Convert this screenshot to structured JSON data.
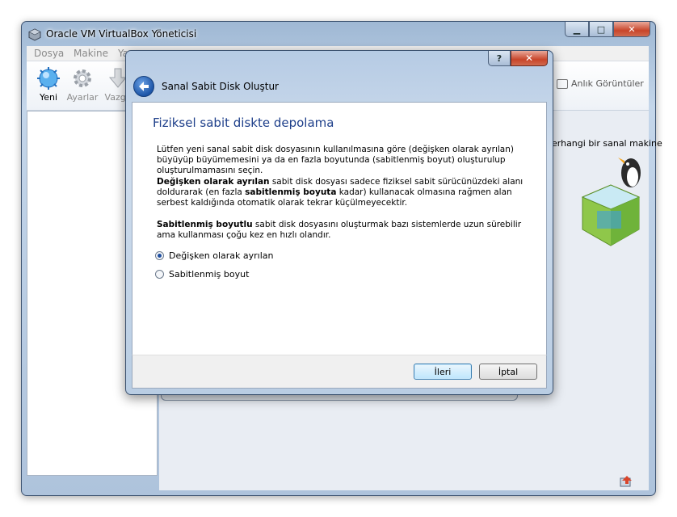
{
  "main_window": {
    "title": "Oracle VM VirtualBox Yöneticisi",
    "menu": [
      "Dosya",
      "Makine",
      "Ya"
    ],
    "toolbar": {
      "new_label": "Yeni",
      "settings_label": "Ayarlar",
      "discard_label": "Vazge",
      "snapshots_label": "Anlık Görüntüler"
    },
    "welcome_text": "erhangi bir sanal makine"
  },
  "dialog": {
    "title": "Sanal Sabit Disk Oluştur",
    "heading": "Fiziksel sabit diskte depolama",
    "intro": "Lütfen yeni sanal sabit disk dosyasının kullanılmasına göre (değişken olarak ayrılan) büyüyüp büyümemesini ya da en fazla boyutunda (sabitlenmiş boyut) oluşturulup oluşturulmamasını seçin.",
    "dynamic_para": {
      "bold1": "Değişken olarak ayrılan",
      "text1": " sabit disk dosyası sadece fiziksel sabit sürücünüzdeki alanı doldurarak (en fazla ",
      "bold2": "sabitlenmiş boyuta",
      "text2": " kadar) kullanacak olmasına rağmen alan serbest kaldığında otomatik olarak tekrar küçülmeyecektir."
    },
    "fixed_para": {
      "bold": "Sabitlenmiş boyutlu",
      "text": " sabit disk dosyasını oluşturmak bazı sistemlerde uzun sürebilir ama kullanması çoğu kez en hızlı olandır."
    },
    "options": [
      {
        "label": "Değişken olarak ayrılan",
        "selected": true
      },
      {
        "label": "Sabitlenmiş boyut",
        "selected": false
      }
    ],
    "buttons": {
      "help": "?",
      "close": "✕",
      "next": "İleri",
      "cancel": "İptal"
    }
  },
  "colors": {
    "heading": "#1e3f8a",
    "frame": "#b6cbe4",
    "close_button": "#c8452a"
  },
  "icons": [
    "virtualbox-icon",
    "new-icon",
    "settings-icon",
    "discard-icon",
    "back-arrow-icon",
    "snapshot-icon",
    "penguin-illustration",
    "status-icon"
  ]
}
